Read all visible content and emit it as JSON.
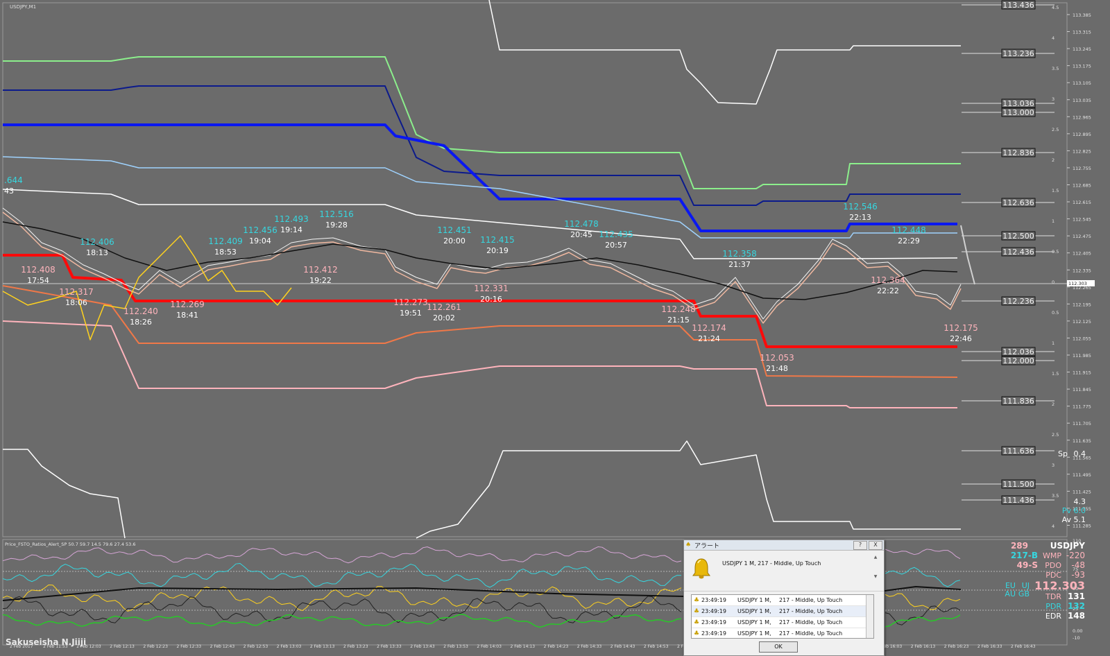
{
  "chart_data": {
    "type": "line",
    "symbol_title": "USDJPY,M1",
    "indicator_title": "Price_FSTO_Ratios_Alert_SP 50.7 59.7 14.5 79.6 27.4 53.6",
    "y_axis_ticks": [
      "113.385",
      "113.315",
      "113.245",
      "113.175",
      "113.105",
      "113.035",
      "112.965",
      "112.895",
      "112.825",
      "112.755",
      "112.685",
      "112.615",
      "112.545",
      "112.475",
      "112.405",
      "112.335",
      "112.265",
      "112.195",
      "112.125",
      "112.055",
      "111.985",
      "111.915",
      "111.845",
      "111.775",
      "111.705",
      "111.635",
      "111.565",
      "111.495",
      "111.425",
      "111.355",
      "111.285"
    ],
    "current_price_label": "112.303",
    "x_axis_ticks": [
      "2 Feb 2017",
      "2 Feb 11:53",
      "2 Feb 12:03",
      "2 Feb 12:13",
      "2 Feb 12:23",
      "2 Feb 12:33",
      "2 Feb 12:43",
      "2 Feb 12:53",
      "2 Feb 13:03",
      "2 Feb 13:13",
      "2 Feb 13:23",
      "2 Feb 13:33",
      "2 Feb 13:43",
      "2 Feb 13:53",
      "2 Feb 14:03",
      "2 Feb 14:13",
      "2 Feb 14:23",
      "2 Feb 14:33",
      "2 Feb 14:43",
      "2 Feb 14:53",
      "2 Feb 15:03",
      "2 Feb 15:13",
      "2 Feb 15:23",
      "2 Feb 15:33",
      "2 Feb 15:43",
      "2 Feb 15:53",
      "2 Feb 16:03",
      "2 Feb 16:13",
      "2 Feb 16:23",
      "2 Feb 16:33",
      "2 Feb 16:43"
    ],
    "level_boxes": [
      "113.436",
      "113.236",
      "113.036",
      "113.000",
      "112.836",
      "112.636",
      "112.500",
      "112.436",
      "112.236",
      "112.036",
      "112.000",
      "111.836",
      "111.636",
      "111.500",
      "111.436"
    ],
    "sigma_labels": [
      "4.5",
      "4",
      "3.5",
      "3",
      "2.5",
      "2",
      "1.5",
      "1",
      "0.5",
      "0",
      "0.5",
      "1",
      "1.5",
      "2",
      "2.5",
      "3",
      "3.5",
      "4"
    ],
    "left_labels": [
      ".644",
      "43"
    ],
    "high_labels": [
      {
        "price": "112.406",
        "time": "18:13"
      },
      {
        "price": "112.409",
        "time": "18:53"
      },
      {
        "price": "112.456",
        "time": "19:04"
      },
      {
        "price": "112.493",
        "time": "19:14"
      },
      {
        "price": "112.516",
        "time": "19:28"
      },
      {
        "price": "112.451",
        "time": "20:00"
      },
      {
        "price": "112.415",
        "time": "20:19"
      },
      {
        "price": "112.478",
        "time": "20:45"
      },
      {
        "price": "112.435",
        "time": "20:57"
      },
      {
        "price": "112.358",
        "time": "21:37"
      },
      {
        "price": "112.546",
        "time": "22:13"
      },
      {
        "price": "112.448",
        "time": "22:29"
      }
    ],
    "low_labels": [
      {
        "price": "112.408",
        "time": "17:54"
      },
      {
        "price": "112.317",
        "time": "18:06"
      },
      {
        "price": "112.240",
        "time": "18:26"
      },
      {
        "price": "112.269",
        "time": "18:41"
      },
      {
        "price": "112.412",
        "time": "19:22"
      },
      {
        "price": "112.273",
        "time": "19:51"
      },
      {
        "price": "112.261",
        "time": "20:02"
      },
      {
        "price": "112.331",
        "time": "20:16"
      },
      {
        "price": "112.248",
        "time": "21:15"
      },
      {
        "price": "112.174",
        "time": "21:24"
      },
      {
        "price": "112.053",
        "time": "21:48"
      },
      {
        "price": "112.364",
        "time": "22:22"
      },
      {
        "price": "112.175",
        "time": "22:46"
      }
    ],
    "right_info": {
      "sp": "Sp",
      "sp_val": "0.4",
      "v1": "4.3",
      "pv": "Pv 6.0",
      "av": "Av 5.1"
    },
    "sub_y_ticks": [
      "110",
      "75",
      "50",
      "25",
      "0.00",
      "-10"
    ],
    "watermark": "Sakuseisha N.Jiiji",
    "stats": {
      "s289": "289",
      "pair": "USDJPY",
      "b217": "217-B",
      "wmp": "WMP",
      "wmp_v": "-220",
      "s49": "49-S",
      "pdo": "PDO",
      "pdo_v": "-48",
      "pdc": "PDC",
      "pdc_v": "-93",
      "eu": "EU",
      "uj": "UJ",
      "price": "112.303",
      "tdr": "TDR",
      "tdr_v": "131",
      "au": "AU",
      "gb": "GB",
      "pdr": "PDR",
      "pdr_v": "132",
      "edr": "EDR",
      "edr_v": "148"
    },
    "colors": {
      "bg": "#6b6b6b",
      "lightgreen": "#8cef8c",
      "navy": "#0b1a8c",
      "blue": "#0a18f0",
      "lightblue": "#9fd3ff",
      "white": "#ffffff",
      "red": "#ff0a0a",
      "orange": "#f07848",
      "pink": "#ffb4bc",
      "yellow": "#ffd21e",
      "black": "#101010",
      "cyan": "#36d7e0",
      "violet": "#d6a5d6",
      "green": "#28c828"
    }
  },
  "alert": {
    "title": "アラート",
    "help_btn": "?",
    "close_btn": "X",
    "message": "USDJPY  1 M,    217 - Middle, Up Touch",
    "rows": [
      {
        "time": "23:49:19",
        "sym": "USDJPY  1 M,",
        "msg": "217 - Middle, Up Touch"
      },
      {
        "time": "23:49:19",
        "sym": "USDJPY  1 M,",
        "msg": "217 - Middle, Up Touch"
      },
      {
        "time": "23:49:19",
        "sym": "USDJPY  1 M,",
        "msg": "217 - Middle, Up Touch"
      },
      {
        "time": "23:49:19",
        "sym": "USDJPY  1 M,",
        "msg": "217 - Middle, Up Touch"
      }
    ],
    "ok_label": "OK"
  }
}
